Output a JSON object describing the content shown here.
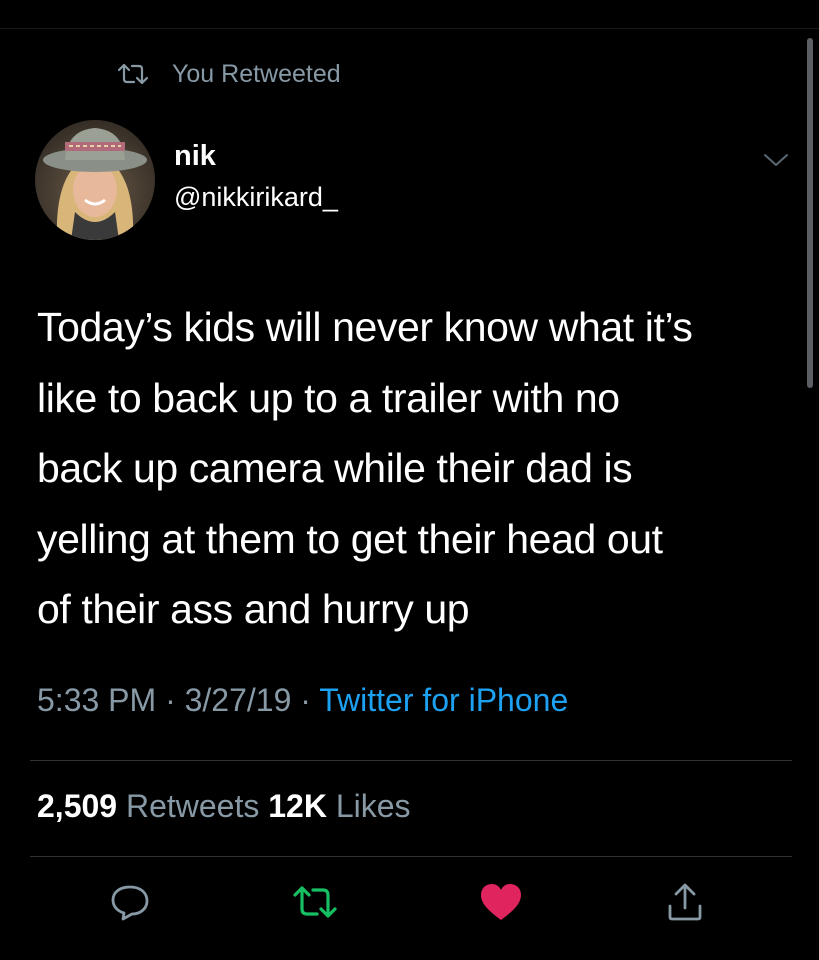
{
  "retweet_context": {
    "label": "You Retweeted",
    "icon": "retweet-icon"
  },
  "author": {
    "display_name": "nik",
    "handle": "@nikkirikard_",
    "avatar_icon": "avatar-photo"
  },
  "tweet": {
    "lines": [
      "Today’s kids will never know what it’s",
      "like to back up to a trailer with no",
      "back up camera while their dad is",
      "yelling at them to get their head out",
      "of their ass and hurry up"
    ]
  },
  "meta": {
    "time": "5:33 PM",
    "date": "3/27/19",
    "separator": "·",
    "source": "Twitter for iPhone"
  },
  "stats": {
    "retweets_count": "2,509",
    "retweets_label": "Retweets",
    "likes_count": "12K",
    "likes_label": "Likes"
  },
  "actions": {
    "reply_icon": "reply-icon",
    "retweet_icon": "retweet-icon",
    "like_icon": "heart-icon",
    "share_icon": "share-icon"
  },
  "colors": {
    "background": "#000000",
    "muted_text": "#8899a6",
    "link": "#1da1f2",
    "retweet_active": "#17bf63",
    "like_active": "#e0245e"
  }
}
